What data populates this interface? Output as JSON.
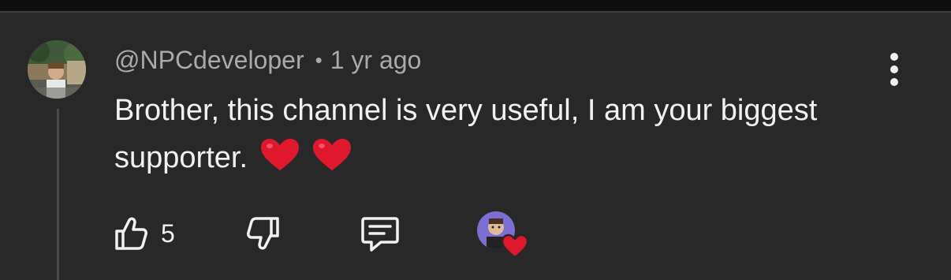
{
  "comment": {
    "author": "@NPCdeveloper",
    "separator": "•",
    "time": "1 yr ago",
    "text": "Brother, this channel is very useful, I am your biggest supporter."
  },
  "actions": {
    "like_count": "5"
  },
  "icons": {
    "more": "more-vert-icon",
    "like": "thumbs-up-icon",
    "dislike": "thumbs-down-icon",
    "reply": "reply-comment-icon",
    "creator_heart": "creator-heart-icon",
    "heart_emoji": "red-heart-icon"
  },
  "colors": {
    "background": "#282828",
    "text_primary": "#f1f1f1",
    "text_secondary": "#aaaaaa",
    "heart": "#e0182d"
  }
}
